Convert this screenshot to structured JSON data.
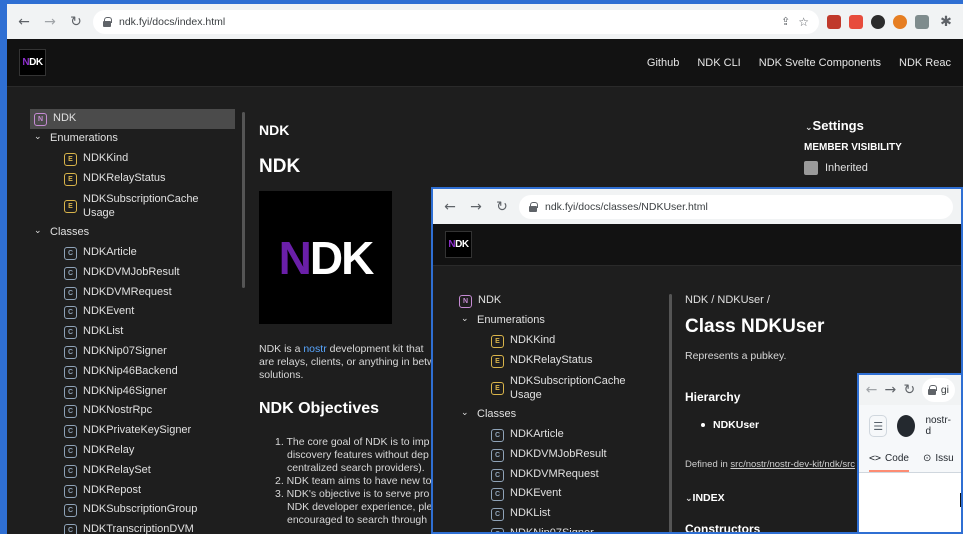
{
  "win1": {
    "url": "ndk.fyi/docs/index.html",
    "toplinks": [
      "Github",
      "NDK CLI",
      "NDK Svelte Components",
      "NDK Reac"
    ],
    "logo": {
      "n": "N",
      "dk": "DK"
    },
    "nav": {
      "root": "NDK",
      "enum_group": "Enumerations",
      "enums": [
        "NDKKind",
        "NDKRelayStatus"
      ],
      "enum_last": [
        "NDKSubscriptionCache",
        "Usage"
      ],
      "class_group": "Classes",
      "classes": [
        "NDKArticle",
        "NDKDVMJobResult",
        "NDKDVMRequest",
        "NDKEvent",
        "NDKList",
        "NDKNip07Signer",
        "NDKNip46Backend",
        "NDKNip46Signer",
        "NDKNostrRpc",
        "NDKPrivateKeySigner",
        "NDKRelay",
        "NDKRelaySet",
        "NDKRepost",
        "NDKSubscriptionGroup",
        "NDKTranscriptionDVM"
      ]
    },
    "breadcrumb": "NDK",
    "title": "NDK",
    "hero": {
      "n": "N",
      "dk": "DK"
    },
    "intro": {
      "pre": "NDK is a ",
      "link": "nostr",
      "post1": " development kit that",
      "line2": "are relays, clients, or anything in betw",
      "line3": "solutions."
    },
    "objectives_title": "NDK Objectives",
    "objectives": [
      [
        "1. The core goal of NDK is to imp",
        "discovery features without dep",
        "centralized search providers)."
      ],
      [
        "2. NDK team aims to have new to"
      ],
      [
        "3. NDK's objective is to serve pro",
        "NDK developer experience, ple",
        "encouraged to search through"
      ]
    ],
    "settings": {
      "title": "Settings",
      "member_visibility": "MEMBER VISIBILITY",
      "inherited": "Inherited"
    }
  },
  "win2": {
    "url": "ndk.fyi/docs/classes/NDKUser.html",
    "logo": {
      "n": "N",
      "dk": "DK"
    },
    "nav": {
      "root": "NDK",
      "enum_group": "Enumerations",
      "enums": [
        "NDKKind",
        "NDKRelayStatus"
      ],
      "enum_last": [
        "NDKSubscriptionCache",
        "Usage"
      ],
      "class_group": "Classes",
      "classes": [
        "NDKArticle",
        "NDKDVMJobResult",
        "NDKDVMRequest",
        "NDKEvent",
        "NDKList",
        "NDKNip07Signer"
      ]
    },
    "breadcrumb": "NDK / NDKUser /",
    "title": "Class NDKUser",
    "subtitle": "Represents a pubkey.",
    "hierarchy_title": "Hierarchy",
    "hierarchy_item": "NDKUser",
    "defined_in_label": "Defined in ",
    "defined_in_link": "src/nostr/nostr-dev-kit/ndk/src",
    "index_label": "INDEX",
    "constructors": "Constructors"
  },
  "win3": {
    "url": "gi",
    "repo": "nostr-d",
    "tab_code": "Code",
    "tab_issues": "Issu"
  }
}
